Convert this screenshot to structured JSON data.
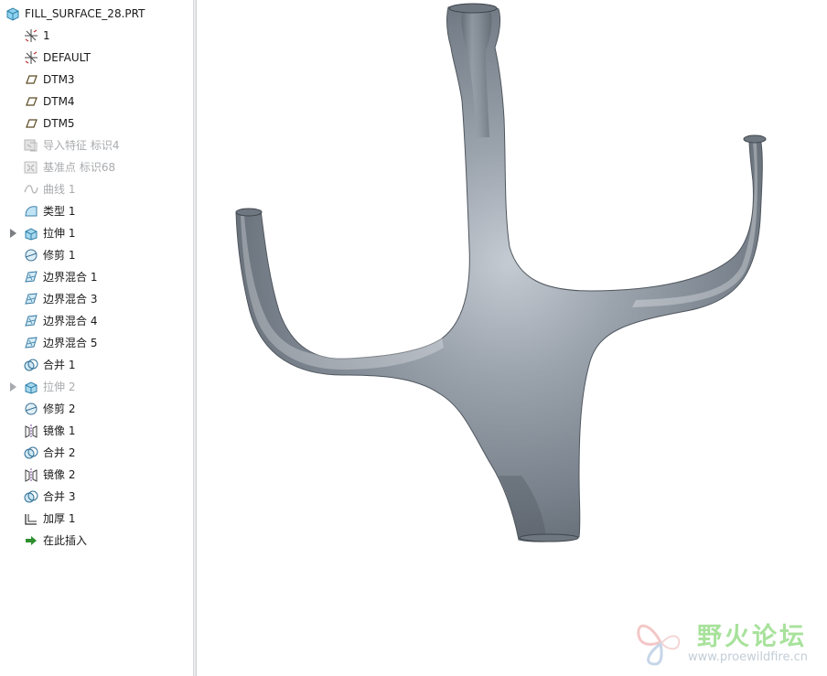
{
  "model_tree": {
    "root": {
      "label": "FILL_SURFACE_28.PRT",
      "icon": "part-icon"
    },
    "items": [
      {
        "label": "1",
        "icon": "coordinate-system-icon",
        "expandable": false,
        "suppressed": false
      },
      {
        "label": "DEFAULT",
        "icon": "coordinate-system-icon",
        "expandable": false,
        "suppressed": false
      },
      {
        "label": "DTM3",
        "icon": "datum-plane-icon",
        "expandable": false,
        "suppressed": false
      },
      {
        "label": "DTM4",
        "icon": "datum-plane-icon",
        "expandable": false,
        "suppressed": false
      },
      {
        "label": "DTM5",
        "icon": "datum-plane-icon",
        "expandable": false,
        "suppressed": false
      },
      {
        "label": "导入特征 标识4",
        "icon": "import-feature-icon",
        "expandable": false,
        "suppressed": true
      },
      {
        "label": "基准点 标识68",
        "icon": "datum-point-icon",
        "expandable": false,
        "suppressed": true
      },
      {
        "label": "曲线 1",
        "icon": "curve-icon",
        "expandable": false,
        "suppressed": true
      },
      {
        "label": "类型 1",
        "icon": "style-surface-icon",
        "expandable": false,
        "suppressed": false
      },
      {
        "label": "拉伸 1",
        "icon": "extrude-icon",
        "expandable": true,
        "suppressed": false
      },
      {
        "label": "修剪 1",
        "icon": "trim-icon",
        "expandable": false,
        "suppressed": false
      },
      {
        "label": "边界混合 1",
        "icon": "boundary-blend-icon",
        "expandable": false,
        "suppressed": false
      },
      {
        "label": "边界混合 3",
        "icon": "boundary-blend-icon",
        "expandable": false,
        "suppressed": false
      },
      {
        "label": "边界混合 4",
        "icon": "boundary-blend-icon",
        "expandable": false,
        "suppressed": false
      },
      {
        "label": "边界混合 5",
        "icon": "boundary-blend-icon",
        "expandable": false,
        "suppressed": false
      },
      {
        "label": "合并 1",
        "icon": "merge-icon",
        "expandable": false,
        "suppressed": false
      },
      {
        "label": "拉伸 2",
        "icon": "extrude-icon",
        "expandable": true,
        "suppressed": true
      },
      {
        "label": "修剪 2",
        "icon": "trim-icon",
        "expandable": false,
        "suppressed": false
      },
      {
        "label": "镜像 1",
        "icon": "mirror-icon",
        "expandable": false,
        "suppressed": false
      },
      {
        "label": "合并 2",
        "icon": "merge-icon",
        "expandable": false,
        "suppressed": false
      },
      {
        "label": "镜像 2",
        "icon": "mirror-icon",
        "expandable": false,
        "suppressed": false
      },
      {
        "label": "合并 3",
        "icon": "merge-icon",
        "expandable": false,
        "suppressed": false
      },
      {
        "label": "加厚 1",
        "icon": "thicken-icon",
        "expandable": false,
        "suppressed": false
      },
      {
        "label": "在此插入",
        "icon": "insert-here-arrow-icon",
        "expandable": false,
        "suppressed": false
      }
    ]
  },
  "graphics": {
    "model_color": "#7f8893",
    "background": "#ffffff"
  },
  "watermark": {
    "title": "野火论坛",
    "url": "www.proewildfire.cn"
  }
}
